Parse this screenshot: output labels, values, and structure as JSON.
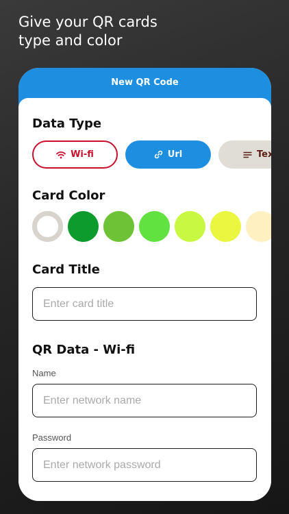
{
  "promo": {
    "line1": "Give your QR cards",
    "line2": "type and color"
  },
  "nav": {
    "title": "New QR Code"
  },
  "data_type": {
    "title": "Data Type",
    "options": [
      {
        "label": "Wi-fi",
        "icon": "wifi-icon",
        "state": "selected-outline",
        "color": "#c8102e"
      },
      {
        "label": "Url",
        "icon": "link-icon",
        "state": "filled",
        "color": "#1e8fe0"
      },
      {
        "label": "Tex",
        "icon": "text-lines-icon",
        "state": "filled",
        "color": "#e0dcd6"
      }
    ]
  },
  "card_color": {
    "title": "Card Color",
    "swatches": [
      {
        "color": "#ffffff",
        "selected": true
      },
      {
        "color": "#0e9b2e",
        "selected": false
      },
      {
        "color": "#6ec236",
        "selected": false
      },
      {
        "color": "#62e240",
        "selected": false
      },
      {
        "color": "#c9f842",
        "selected": false
      },
      {
        "color": "#eaf63f",
        "selected": false
      },
      {
        "color": "#fff0c2",
        "selected": false
      }
    ]
  },
  "card_title": {
    "title": "Card Title",
    "value": "",
    "placeholder": "Enter card title"
  },
  "qr_data": {
    "title": "QR Data - Wi-fi",
    "name_label": "Name",
    "name_value": "",
    "name_placeholder": "Enter network name",
    "password_label": "Password",
    "password_value": "",
    "password_placeholder": "Enter network password"
  },
  "colors": {
    "accent": "#1e8fe0",
    "wifi_red": "#c8102e"
  }
}
